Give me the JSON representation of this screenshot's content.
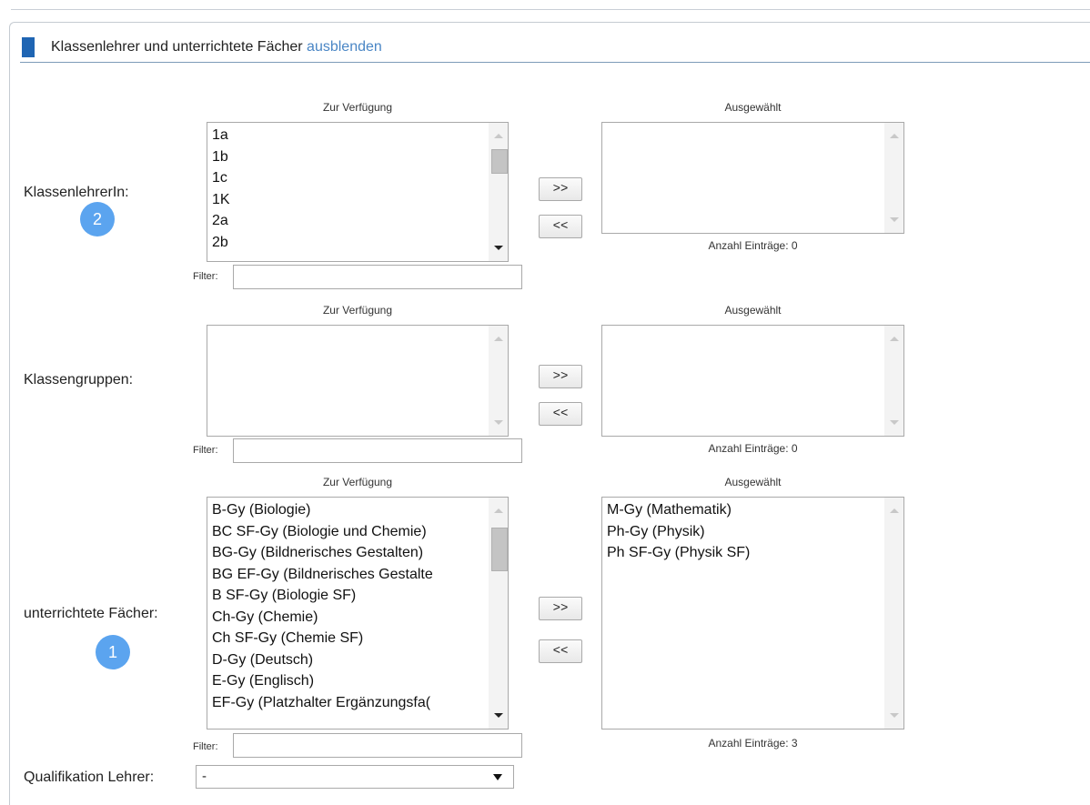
{
  "section": {
    "title": "Klassenlehrer und unterrichtete Fächer",
    "toggle_label": "ausblenden"
  },
  "common": {
    "available_label": "Zur Verfügung",
    "selected_label": "Ausgewählt",
    "filter_label": "Filter:",
    "add_label": ">>",
    "remove_label": "<<"
  },
  "class_teacher": {
    "label": "KlassenlehrerIn:",
    "badge": "2",
    "available": [
      "1a",
      "1b",
      "1c",
      "1K",
      "2a",
      "2b"
    ],
    "selected": [],
    "count_text": "Anzahl Einträge: 0",
    "filter_value": ""
  },
  "class_groups": {
    "label": "Klassengruppen:",
    "available": [],
    "selected": [],
    "count_text": "Anzahl Einträge: 0",
    "filter_value": ""
  },
  "subjects": {
    "label": "unterrichtete Fächer:",
    "badge": "1",
    "available": [
      "B-Gy (Biologie)",
      "BC SF-Gy (Biologie und Chemie)",
      "BG-Gy (Bildnerisches Gestalten)",
      "BG EF-Gy (Bildnerisches Gestalte",
      "B SF-Gy (Biologie SF)",
      "Ch-Gy (Chemie)",
      "Ch SF-Gy (Chemie SF)",
      "D-Gy (Deutsch)",
      "E-Gy (Englisch)",
      "EF-Gy (Platzhalter Ergänzungsfa("
    ],
    "selected": [
      "M-Gy (Mathematik)",
      "Ph-Gy (Physik)",
      "Ph SF-Gy (Physik SF)"
    ],
    "count_text": "Anzahl Einträge: 3",
    "filter_value": ""
  },
  "qualification": {
    "label": "Qualifikation Lehrer:",
    "value": "-"
  },
  "colors": {
    "accent": "#1f65b3",
    "link": "#4a86c5",
    "badge": "#5ba4ef"
  }
}
